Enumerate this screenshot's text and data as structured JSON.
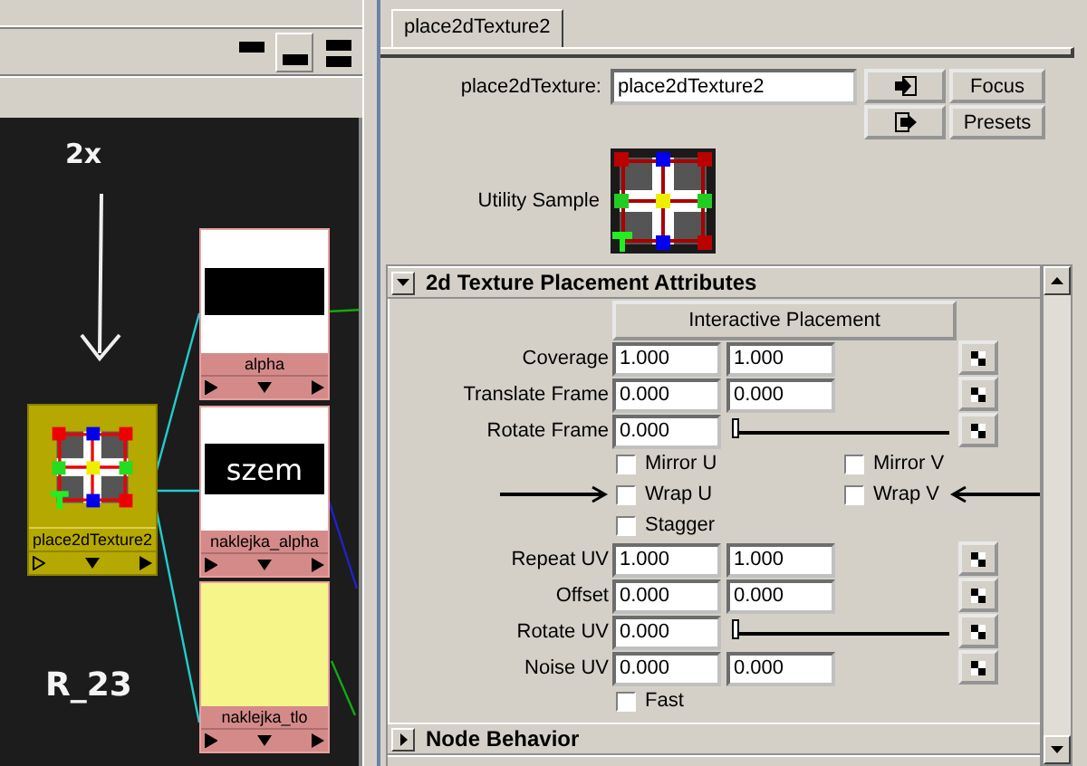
{
  "graph": {
    "layout_buttons": [
      {
        "selected": false
      },
      {
        "selected": true
      },
      {
        "selected": false
      }
    ],
    "annotation_top": "2x",
    "annotation_bottom": "R_23",
    "nodes": [
      {
        "label": "place2dTexture2",
        "kind": "place2d"
      },
      {
        "label": "alpha",
        "kind": "bar"
      },
      {
        "label": "naklejka_alpha",
        "kind": "text",
        "swatch_text": "szem"
      },
      {
        "label": "naklejka_tlo",
        "kind": "color"
      }
    ]
  },
  "editor": {
    "tabs": [
      {
        "label": "place2dTexture2",
        "selected": true
      }
    ],
    "name_label": "place2dTexture:",
    "name_value": "place2dTexture2",
    "buttons": [
      "Focus",
      "Presets"
    ],
    "sample_label": "Utility Sample",
    "sections": [
      {
        "title": "2d Texture Placement Attributes",
        "expanded": true,
        "action": "Interactive Placement",
        "rows": [
          {
            "kind": "pair",
            "label": "Coverage",
            "values": [
              "1.000",
              "1.000"
            ]
          },
          {
            "kind": "pair",
            "label": "Translate Frame",
            "values": [
              "0.000",
              "0.000"
            ]
          },
          {
            "kind": "slider",
            "label": "Rotate Frame",
            "values": [
              "0.000"
            ],
            "level": 0
          },
          {
            "kind": "checks",
            "items": [
              {
                "label": "Mirror U",
                "checked": false
              },
              {
                "label": "Mirror V",
                "checked": false
              }
            ]
          },
          {
            "kind": "checks",
            "arrows": true,
            "items": [
              {
                "label": "Wrap U",
                "checked": false
              },
              {
                "label": "Wrap V",
                "checked": false
              }
            ]
          },
          {
            "kind": "checks",
            "items": [
              {
                "label": "Stagger",
                "checked": false
              }
            ]
          },
          {
            "kind": "pair",
            "label": "Repeat UV",
            "values": [
              "1.000",
              "1.000"
            ]
          },
          {
            "kind": "pair",
            "label": "Offset",
            "values": [
              "0.000",
              "0.000"
            ]
          },
          {
            "kind": "slider",
            "label": "Rotate UV",
            "values": [
              "0.000"
            ],
            "level": 0
          },
          {
            "kind": "pair",
            "label": "Noise UV",
            "values": [
              "0.000",
              "0.000"
            ]
          },
          {
            "kind": "checks",
            "items": [
              {
                "label": "Fast",
                "checked": false
              }
            ]
          }
        ]
      },
      {
        "title": "Node Behavior",
        "expanded": false
      }
    ]
  }
}
